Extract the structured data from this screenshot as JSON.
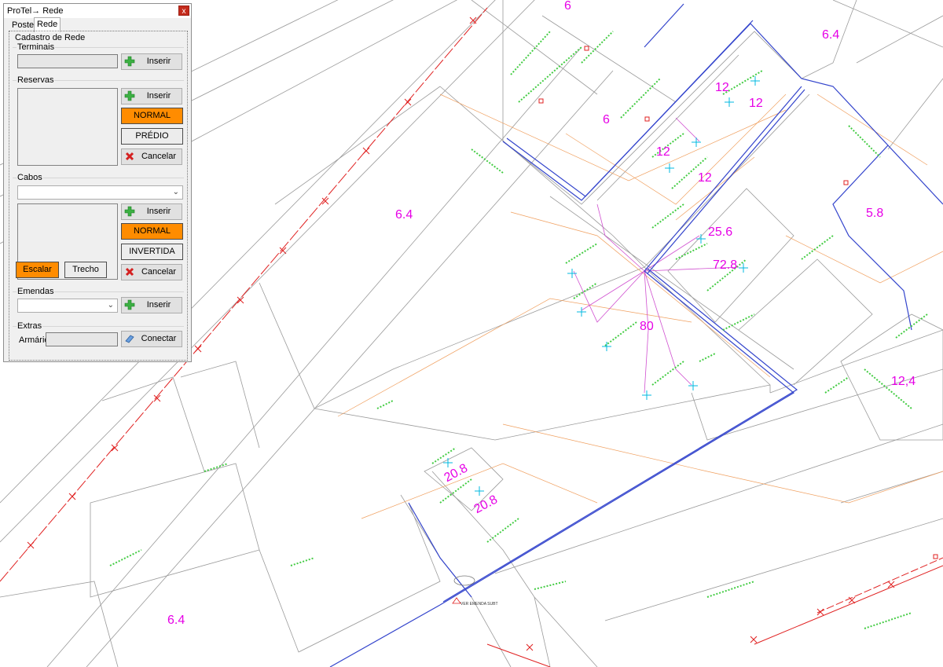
{
  "window": {
    "title": "ProTel→ Rede",
    "close_label": "x"
  },
  "tabs": [
    {
      "label": "Postes"
    },
    {
      "label": "Rede"
    }
  ],
  "panel": {
    "group_title": "Cadastro de Rede",
    "terminais": {
      "title": "Terminais",
      "value": "",
      "insert_label": "Inserir"
    },
    "reservas": {
      "title": "Reservas",
      "insert_label": "Inserir",
      "normal_label": "NORMAL",
      "predio_label": "PRÉDIO",
      "cancel_label": "Cancelar"
    },
    "cabos": {
      "title": "Cabos",
      "combo_value": "",
      "insert_label": "Inserir",
      "normal_label": "NORMAL",
      "invertida_label": "INVERTIDA",
      "cancel_label": "Cancelar",
      "escalar_label": "Escalar",
      "trecho_label": "Trecho"
    },
    "emendas": {
      "title": "Emendas",
      "combo_value": "",
      "insert_label": "Inserir"
    },
    "extras": {
      "title": "Extras",
      "armario_label": "Armário:",
      "armario_value": "",
      "connect_label": "Conectar"
    }
  },
  "map": {
    "labels": [
      "6",
      "6.4",
      "12",
      "12",
      "6",
      "12",
      "12",
      "6.4",
      "5.8",
      "25.6",
      "72.8",
      "80",
      "12,4",
      "20.8",
      "20.8",
      "6.4"
    ],
    "annotation": "VER EMENDA SUBT"
  },
  "colors": {
    "accent_orange": "#ff8c00",
    "label_magenta": "#e600e6",
    "network_blue": "#3344cc",
    "cable_red": "#e02020",
    "device_cyan": "#00c8e6",
    "vegetation_green": "#44cc44"
  }
}
